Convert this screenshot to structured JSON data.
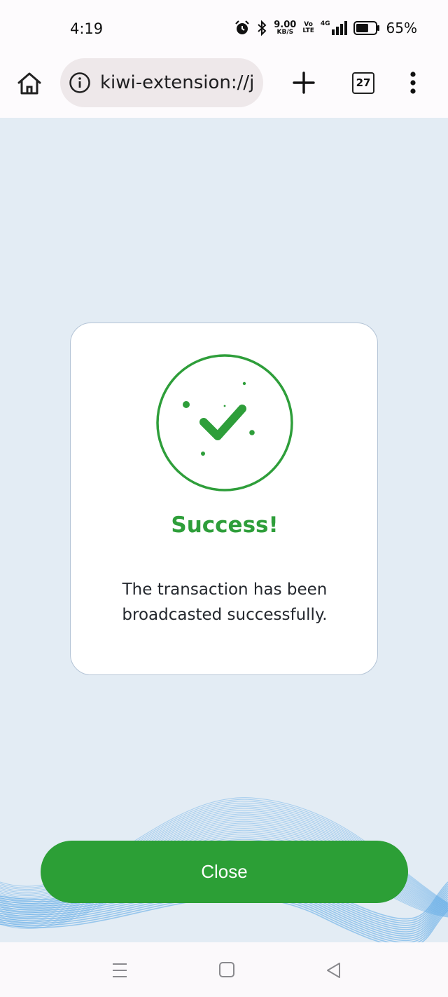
{
  "status_bar": {
    "time": "4:19",
    "speed_value": "9.00",
    "speed_unit": "KB/S",
    "volte_top": "Vo",
    "volte_bottom": "LTE",
    "network": "4G",
    "battery": "65%",
    "battery_level": 0.65,
    "icons": [
      "alarm-icon",
      "bluetooth-icon",
      "signal-icon",
      "battery-icon"
    ]
  },
  "browser": {
    "url": "kiwi-extension://jl",
    "tab_count": "27",
    "icons": [
      "home-icon",
      "info-icon",
      "plus-icon",
      "more-vertical-icon"
    ]
  },
  "dialog": {
    "title": "Success!",
    "message": "The transaction has been broadcasted successfully.",
    "icon": "check-circle-icon"
  },
  "actions": {
    "close_label": "Close"
  },
  "nav": {
    "icons": [
      "recents-icon",
      "home-square-icon",
      "back-icon"
    ]
  },
  "colors": {
    "accent": "#2c9f36",
    "success_text": "#2e9e3a",
    "background": "#e3ecf4",
    "card_border": "#b4c4d6",
    "wave": "#5aa8e6"
  }
}
